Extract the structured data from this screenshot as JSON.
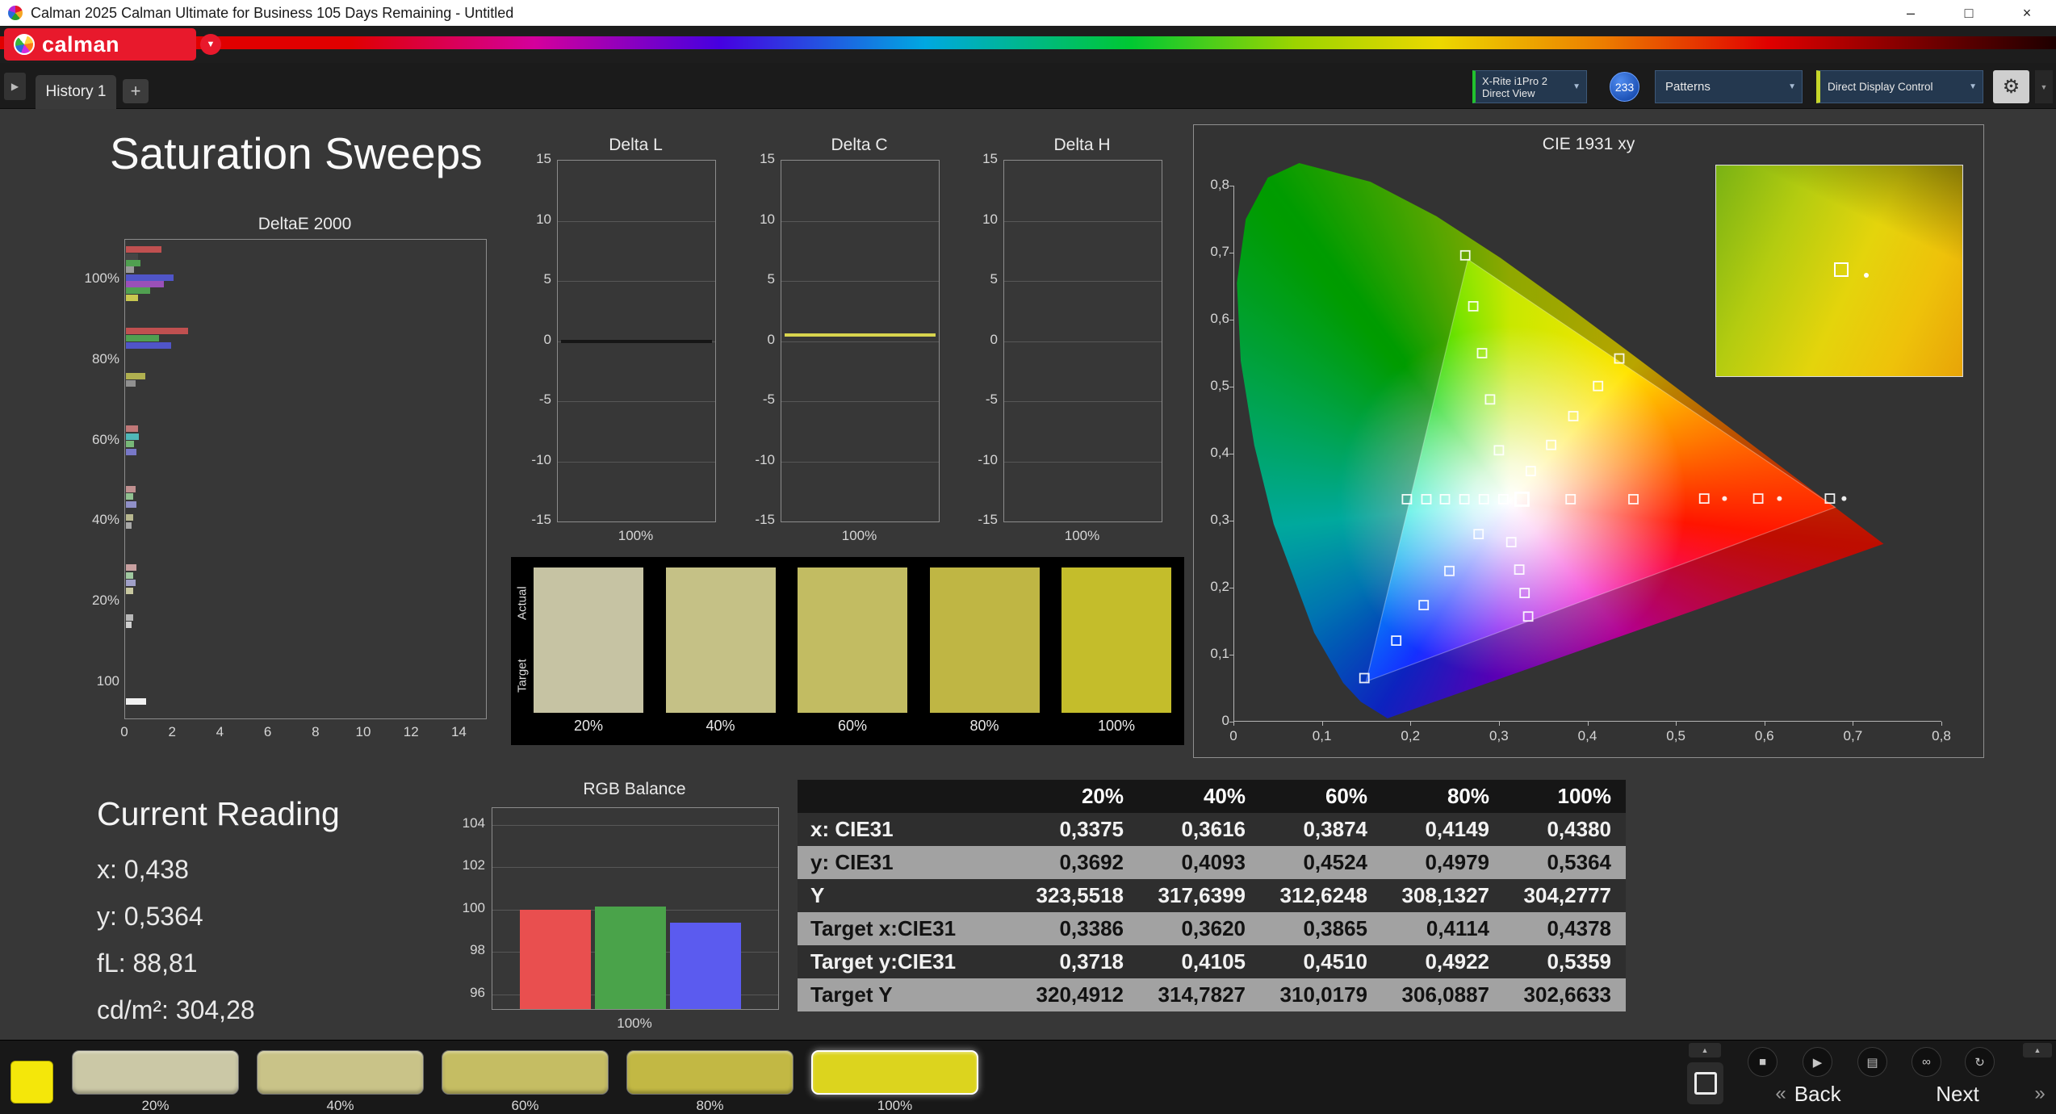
{
  "window": {
    "title": "Calman 2025 Calman Ultimate for Business 105 Days Remaining  - Untitled",
    "controls": {
      "minimize": "–",
      "maximize": "□",
      "close": "×"
    }
  },
  "brand": {
    "name": "calman",
    "caret": "▼"
  },
  "tabs": {
    "scroll_icon": "▶",
    "history": "History 1",
    "add": "+"
  },
  "toolbar": {
    "meter_line1": "X-Rite i1Pro 2",
    "meter_line2": "Direct View",
    "badge": "233",
    "patterns": "Patterns",
    "display_control": "Direct Display Control",
    "caret": "▼",
    "gear": "⚙",
    "corner_icon": "▼"
  },
  "page_title": "Saturation Sweeps",
  "delta_e": {
    "title": "DeltaE 2000",
    "y_labels": [
      "100%",
      "80%",
      "60%",
      "40%",
      "20%",
      "100"
    ],
    "x_ticks": [
      "0",
      "2",
      "4",
      "6",
      "8",
      "10",
      "12",
      "14"
    ],
    "x_max": 15.1,
    "bars": [
      {
        "f": 0.014,
        "c": "#c05050",
        "v": 1.5
      },
      {
        "f": 0.028,
        "c": "#454545",
        "v": 0.5
      },
      {
        "f": 0.042,
        "c": "#50a050",
        "v": 0.6
      },
      {
        "f": 0.056,
        "c": "#9a9a9a",
        "v": 0.35
      },
      {
        "f": 0.072,
        "c": "#5055c8",
        "v": 2.0
      },
      {
        "f": 0.086,
        "c": "#9a50b8",
        "v": 1.6
      },
      {
        "f": 0.1,
        "c": "#50a050",
        "v": 1.0
      },
      {
        "f": 0.114,
        "c": "#c8c850",
        "v": 0.5
      },
      {
        "f": 0.183,
        "c": "#c05050",
        "v": 2.6
      },
      {
        "f": 0.199,
        "c": "#50a050",
        "v": 1.4
      },
      {
        "f": 0.215,
        "c": "#5055c8",
        "v": 1.9
      },
      {
        "f": 0.278,
        "c": "#b0b050",
        "v": 0.8
      },
      {
        "f": 0.294,
        "c": "#909090",
        "v": 0.4
      },
      {
        "f": 0.388,
        "c": "#c07878",
        "v": 0.5
      },
      {
        "f": 0.404,
        "c": "#50b8b8",
        "v": 0.55
      },
      {
        "f": 0.42,
        "c": "#78b878",
        "v": 0.35
      },
      {
        "f": 0.436,
        "c": "#7878c8",
        "v": 0.45
      },
      {
        "f": 0.514,
        "c": "#c09090",
        "v": 0.4
      },
      {
        "f": 0.53,
        "c": "#90c090",
        "v": 0.3
      },
      {
        "f": 0.546,
        "c": "#9090c8",
        "v": 0.45
      },
      {
        "f": 0.574,
        "c": "#b8b890",
        "v": 0.3
      },
      {
        "f": 0.59,
        "c": "#a8a8a8",
        "v": 0.25
      },
      {
        "f": 0.678,
        "c": "#c8a0a0",
        "v": 0.45
      },
      {
        "f": 0.694,
        "c": "#a0c8a0",
        "v": 0.3
      },
      {
        "f": 0.71,
        "c": "#a0a0c8",
        "v": 0.4
      },
      {
        "f": 0.726,
        "c": "#c8c8a0",
        "v": 0.3
      },
      {
        "f": 0.782,
        "c": "#b8b8b8",
        "v": 0.3
      },
      {
        "f": 0.798,
        "c": "#d0d0d0",
        "v": 0.25
      },
      {
        "f": 0.958,
        "c": "#f0f0f0",
        "v": 0.85
      }
    ]
  },
  "delta_l": {
    "title": "Delta L",
    "y_ticks": [
      "15",
      "10",
      "5",
      "0",
      "-5",
      "-10",
      "-15"
    ],
    "x_label": "100%",
    "line": {
      "value": 0,
      "color": "#161616"
    }
  },
  "delta_c": {
    "title": "Delta C",
    "y_ticks": [
      "15",
      "10",
      "5",
      "0",
      "-5",
      "-10",
      "-15"
    ],
    "x_label": "100%",
    "line": {
      "value": 0.5,
      "color": "#d8d44e"
    }
  },
  "delta_h": {
    "title": "Delta H",
    "y_ticks": [
      "15",
      "10",
      "5",
      "0",
      "-5",
      "-10",
      "-15"
    ],
    "x_label": "100%",
    "line": null
  },
  "swatches": {
    "row_labels": [
      "Actual",
      "Target"
    ],
    "items": [
      {
        "label": "20%",
        "color": "#c6c3a3"
      },
      {
        "label": "40%",
        "color": "#c5c186"
      },
      {
        "label": "60%",
        "color": "#c2bc62"
      },
      {
        "label": "80%",
        "color": "#bfb644"
      },
      {
        "label": "100%",
        "color": "#c4bd2b"
      }
    ]
  },
  "cie": {
    "title": "CIE 1931 xy",
    "x_ticks": [
      "0",
      "0,1",
      "0,2",
      "0,3",
      "0,4",
      "0,5",
      "0,6",
      "0,7",
      "0,8"
    ],
    "y_ticks": [
      "0,8",
      "0,7",
      "0,6",
      "0,5",
      "0,4",
      "0,3",
      "0,2",
      "0,1",
      "0"
    ],
    "gamut": [
      [
        0.68,
        0.32
      ],
      [
        0.265,
        0.69
      ],
      [
        0.15,
        0.06
      ]
    ],
    "current_marker": [
      0.326,
      0.332
    ],
    "markers": [
      [
        0.196,
        0.332
      ],
      [
        0.218,
        0.332
      ],
      [
        0.239,
        0.332
      ],
      [
        0.261,
        0.332
      ],
      [
        0.283,
        0.332
      ],
      [
        0.305,
        0.332
      ],
      [
        0.381,
        0.332
      ],
      [
        0.452,
        0.332
      ],
      [
        0.532,
        0.333
      ],
      [
        0.593,
        0.333
      ],
      [
        0.674,
        0.333
      ],
      [
        0.336,
        0.374
      ],
      [
        0.359,
        0.413
      ],
      [
        0.384,
        0.456
      ],
      [
        0.412,
        0.501
      ],
      [
        0.436,
        0.542
      ],
      [
        0.262,
        0.696
      ],
      [
        0.271,
        0.62
      ],
      [
        0.281,
        0.55
      ],
      [
        0.29,
        0.481
      ],
      [
        0.3,
        0.405
      ],
      [
        0.277,
        0.28
      ],
      [
        0.244,
        0.225
      ],
      [
        0.215,
        0.174
      ],
      [
        0.184,
        0.121
      ],
      [
        0.148,
        0.065
      ],
      [
        0.314,
        0.268
      ],
      [
        0.323,
        0.227
      ],
      [
        0.329,
        0.192
      ],
      [
        0.333,
        0.157
      ]
    ],
    "dots": [
      [
        0.555,
        0.333
      ],
      [
        0.617,
        0.333
      ],
      [
        0.69,
        0.333
      ]
    ]
  },
  "current_reading": {
    "title": "Current Reading",
    "x": "x: 0,438",
    "y": "y: 0,5364",
    "fl": "fL: 88,81",
    "cd": "cd/m²: 304,28"
  },
  "rgb_balance": {
    "title": "RGB Balance",
    "y_ticks": [
      104,
      102,
      100,
      98,
      96
    ],
    "y_range": [
      95.3,
      104.8
    ],
    "x_label": "100%",
    "bars": [
      {
        "name": "red",
        "color": "#e94f4f",
        "value": 100.0
      },
      {
        "name": "green",
        "color": "#4aa34a",
        "value": 100.15
      },
      {
        "name": "blue",
        "color": "#5b5bef",
        "value": 99.4
      }
    ]
  },
  "table": {
    "columns": [
      "20%",
      "40%",
      "60%",
      "80%",
      "100%"
    ],
    "rows": [
      {
        "label": "x: CIE31",
        "values": [
          "0,3375",
          "0,3616",
          "0,3874",
          "0,4149",
          "0,4380"
        ]
      },
      {
        "label": "y: CIE31",
        "values": [
          "0,3692",
          "0,4093",
          "0,4524",
          "0,4979",
          "0,5364"
        ]
      },
      {
        "label": "Y",
        "values": [
          "323,5518",
          "317,6399",
          "312,6248",
          "308,1327",
          "304,2777"
        ]
      },
      {
        "label": "Target x:CIE31",
        "values": [
          "0,3386",
          "0,3620",
          "0,3865",
          "0,4114",
          "0,4378"
        ]
      },
      {
        "label": "Target y:CIE31",
        "values": [
          "0,3718",
          "0,4105",
          "0,4510",
          "0,4922",
          "0,5359"
        ]
      },
      {
        "label": "Target Y",
        "values": [
          "320,4912",
          "314,7827",
          "310,0179",
          "306,0887",
          "302,6633"
        ]
      }
    ]
  },
  "bottom": {
    "swatches": [
      {
        "label": "20%",
        "color": "#cbc8a6"
      },
      {
        "label": "40%",
        "color": "#c9c388"
      },
      {
        "label": "60%",
        "color": "#c5bd63"
      },
      {
        "label": "80%",
        "color": "#c2b844"
      },
      {
        "label": "100%",
        "color": "#dcd41e",
        "selected": true
      }
    ],
    "controls": [
      "■",
      "▶",
      "▤",
      "∞",
      "↻"
    ],
    "scroll_up": "▲",
    "back_chevron": "«",
    "back": "Back",
    "next": "Next",
    "next_chevron": "»"
  }
}
